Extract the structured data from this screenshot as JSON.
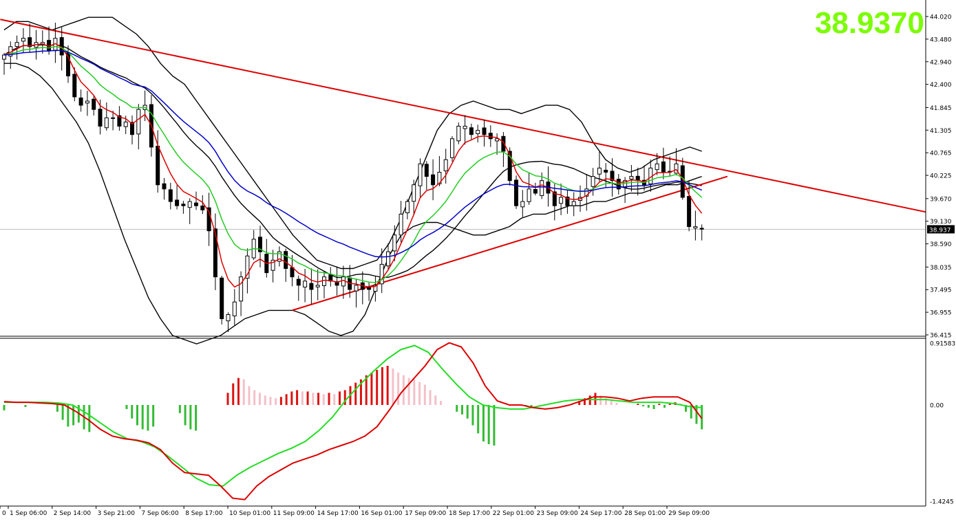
{
  "price_display": "38.9370",
  "current_price_tag": "38.937",
  "colors": {
    "price_big": "#7cfc00",
    "trendline": "#dd0000",
    "ma_fast": "#dd0000",
    "ma_mid": "#22cc22",
    "ma_slow": "#0000cc",
    "bollinger": "#000000",
    "hist_up_strong": "#dd1111",
    "hist_up_weak": "#f4c0c8",
    "hist_down": "#33bb33",
    "macd_line": "#dd0000",
    "signal_line": "#22dd22"
  },
  "chart_data": [
    {
      "type": "candlestick",
      "panel": "price",
      "title": "",
      "ylim": [
        36.415,
        44.02
      ],
      "y_ticks": [
        "44.020",
        "43.480",
        "42.940",
        "42.400",
        "41.845",
        "41.305",
        "40.765",
        "40.225",
        "39.670",
        "39.130",
        "38.590",
        "38.035",
        "37.495",
        "36.955",
        "36.415"
      ],
      "x_ticks": [
        "0",
        "1 Sep 06:00",
        "2 Sep 14:00",
        "3 Sep 21:00",
        "7 Sep 06:00",
        "8 Sep 17:00",
        "10 Sep 01:00",
        "11 Sep 09:00",
        "14 Sep 17:00",
        "16 Sep 01:00",
        "17 Sep 09:00",
        "18 Sep 17:00",
        "22 Sep 01:00",
        "23 Sep 09:00",
        "24 Sep 17:00",
        "28 Sep 01:00",
        "29 Sep 09:00"
      ],
      "last_price": 38.937,
      "close_path": [
        43.1,
        43.3,
        43.4,
        43.5,
        43.3,
        43.4,
        43.4,
        43.2,
        43.5,
        43.1,
        42.6,
        42.1,
        41.9,
        42.0,
        41.8,
        41.4,
        41.6,
        41.6,
        41.4,
        41.5,
        41.2,
        41.8,
        41.9,
        40.9,
        40.0,
        39.9,
        39.6,
        39.5,
        39.5,
        39.6,
        39.5,
        39.4,
        38.9,
        37.8,
        36.8,
        36.9,
        37.2,
        37.8,
        38.3,
        38.7,
        38.4,
        37.9,
        38.2,
        38.4,
        38.0,
        37.8,
        37.6,
        37.7,
        37.5,
        37.6,
        37.8,
        37.7,
        37.6,
        37.8,
        37.5,
        37.6,
        37.5,
        37.5,
        37.6,
        38.1,
        38.4,
        38.8,
        39.3,
        39.6,
        40.0,
        40.5,
        40.2,
        40.0,
        40.3,
        40.6,
        41.1,
        41.4,
        41.4,
        41.2,
        41.3,
        41.2,
        41.1,
        41.1,
        40.8,
        40.1,
        39.5,
        39.6,
        39.9,
        39.8,
        40.1,
        39.8,
        39.5,
        39.7,
        39.5,
        39.6,
        39.7,
        39.9,
        40.2,
        40.4,
        40.3,
        40.1,
        39.9,
        40.1,
        40.2,
        40.1,
        40.0,
        40.4,
        40.5,
        40.3,
        40.3,
        40.5,
        39.7,
        39.0,
        39.0,
        38.94
      ],
      "bollinger_upper": [
        43.7,
        43.9,
        43.9,
        43.8,
        43.7,
        43.8,
        43.9,
        44.0,
        44.0,
        44.0,
        43.8,
        43.6,
        43.3,
        42.9,
        42.6,
        42.4,
        42.0,
        41.6,
        41.2,
        40.8,
        40.4,
        40.0,
        39.6,
        39.2,
        38.8,
        38.5,
        38.2,
        38.1,
        38.0,
        38.0,
        38.1,
        38.2,
        38.6,
        39.2,
        39.9,
        40.6,
        41.3,
        41.7,
        41.9,
        42.0,
        41.9,
        41.8,
        41.8,
        41.7,
        41.8,
        41.9,
        41.9,
        41.8,
        41.5,
        41.0,
        40.6,
        40.4,
        40.3,
        40.4,
        40.6,
        40.7,
        40.8,
        40.9,
        40.8
      ],
      "bollinger_lower": [
        42.9,
        42.9,
        42.8,
        42.6,
        42.3,
        41.9,
        41.5,
        41.0,
        40.3,
        39.5,
        38.7,
        38.0,
        37.3,
        36.8,
        36.4,
        36.3,
        36.2,
        36.3,
        36.4,
        36.6,
        36.8,
        36.9,
        37.0,
        37.0,
        37.0,
        36.9,
        36.7,
        36.5,
        36.4,
        36.5,
        36.9,
        37.6,
        38.3,
        38.8,
        39.0,
        39.1,
        39.1,
        39.0,
        38.9,
        38.8,
        38.8,
        38.9,
        39.0,
        39.2,
        39.3,
        39.3,
        39.4,
        39.5,
        39.5,
        39.6,
        39.6,
        39.7,
        39.8,
        39.8,
        39.9,
        40.0,
        40.0,
        40.1,
        40.2
      ]
    },
    {
      "type": "histogram+lines",
      "panel": "macd",
      "title": "",
      "ylim": [
        -1.4245,
        0.91583
      ],
      "y_ticks": [
        "0.91583",
        "0.00",
        "-1.4245"
      ],
      "histogram": [
        -0.08,
        0.0,
        0.0,
        0.0,
        -0.03,
        0.0,
        0.0,
        0.0,
        0.0,
        0.0,
        -0.1,
        -0.22,
        -0.32,
        -0.3,
        -0.26,
        -0.36,
        -0.4,
        0.0,
        0.0,
        0.0,
        0.0,
        0.0,
        0.0,
        -0.06,
        -0.2,
        -0.3,
        -0.36,
        -0.38,
        -0.32,
        0.0,
        0.0,
        0.0,
        0.0,
        -0.12,
        -0.3,
        -0.36,
        -0.38,
        0.0,
        0.0,
        0.0,
        0.0,
        0.0,
        0.18,
        0.32,
        0.4,
        0.38,
        0.28,
        0.22,
        0.18,
        0.14,
        0.12,
        0.1,
        0.12,
        0.16,
        0.2,
        0.22,
        0.2,
        0.2,
        0.18,
        0.18,
        0.16,
        0.18,
        0.16,
        0.2,
        0.22,
        0.28,
        0.33,
        0.38,
        0.44,
        0.48,
        0.52,
        0.56,
        0.58,
        0.54,
        0.48,
        0.44,
        0.4,
        0.38,
        0.34,
        0.3,
        0.22,
        0.14,
        0.06,
        0.0,
        0.0,
        -0.1,
        -0.14,
        -0.2,
        -0.3,
        -0.42,
        -0.54,
        -0.58,
        -0.6,
        0.0,
        0.0,
        0.0,
        0.0,
        0.0,
        -0.02,
        -0.04,
        0.0,
        0.0,
        0.0,
        0.0,
        0.0,
        0.0,
        0.0,
        0.0,
        0.06,
        0.1,
        0.14,
        0.18,
        0.14,
        0.1,
        0.06,
        0.03,
        0.0,
        0.0,
        0.0,
        0.02,
        -0.02,
        -0.04,
        -0.06,
        0.02,
        -0.04,
        0.03,
        0.04,
        0.02,
        -0.1,
        -0.2,
        -0.28,
        -0.36
      ],
      "macd_line": [
        0.05,
        0.04,
        0.04,
        0.03,
        0.02,
        0.0,
        -0.1,
        -0.22,
        -0.36,
        -0.46,
        -0.5,
        -0.52,
        -0.56,
        -0.66,
        -0.86,
        -1.0,
        -1.02,
        -1.04,
        -1.2,
        -1.38,
        -1.4,
        -1.2,
        -1.06,
        -0.96,
        -0.86,
        -0.8,
        -0.74,
        -0.66,
        -0.6,
        -0.54,
        -0.46,
        -0.32,
        -0.08,
        0.18,
        0.38,
        0.58,
        0.82,
        0.92,
        0.86,
        0.62,
        0.28,
        0.06,
        0.0,
        0.0,
        -0.04,
        -0.06,
        -0.04,
        0.0,
        0.06,
        0.12,
        0.12,
        0.1,
        0.06,
        0.1,
        0.12,
        0.12,
        0.12,
        0.04,
        -0.2
      ],
      "signal_line": [
        0.04,
        0.04,
        0.04,
        0.04,
        0.03,
        0.0,
        -0.12,
        -0.26,
        -0.4,
        -0.5,
        -0.54,
        -0.62,
        -0.76,
        -0.92,
        -1.08,
        -1.18,
        -1.2,
        -1.04,
        -0.92,
        -0.82,
        -0.72,
        -0.64,
        -0.54,
        -0.38,
        -0.18,
        0.08,
        0.3,
        0.5,
        0.68,
        0.82,
        0.88,
        0.78,
        0.54,
        0.32,
        0.12,
        0.0,
        -0.04,
        -0.06,
        -0.06,
        -0.02,
        0.02,
        0.06,
        0.08,
        0.08,
        0.08,
        0.06,
        0.04,
        0.04,
        0.04,
        0.02,
        -0.02,
        -0.04
      ]
    }
  ]
}
